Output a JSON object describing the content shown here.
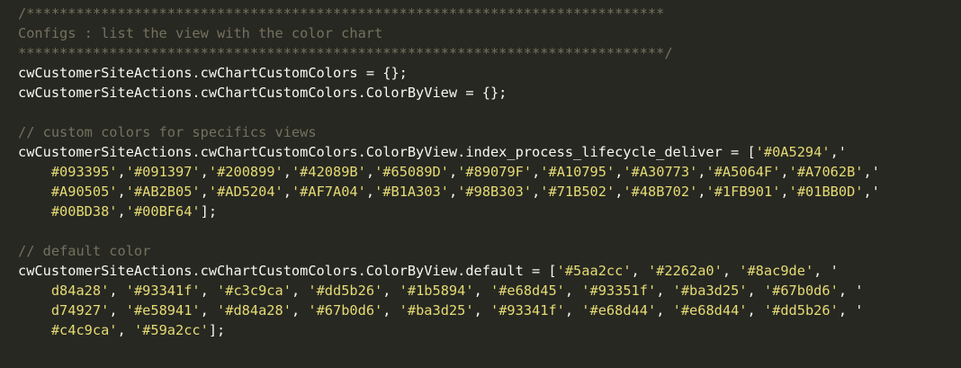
{
  "editor": {
    "lines": [
      {
        "type": "comment",
        "text": "/*****************************************************************************"
      },
      {
        "type": "comment",
        "text": "Configs : list the view with the color chart"
      },
      {
        "type": "comment",
        "text": "******************************************************************************/"
      },
      {
        "type": "code",
        "parts": [
          {
            "k": "plain",
            "t": "cwCustomerSiteActions.cwChartCustomColors "
          },
          {
            "k": "op",
            "t": "="
          },
          {
            "k": "plain",
            "t": " {};"
          }
        ]
      },
      {
        "type": "code",
        "parts": [
          {
            "k": "plain",
            "t": "cwCustomerSiteActions.cwChartCustomColors.ColorByView "
          },
          {
            "k": "op",
            "t": "="
          },
          {
            "k": "plain",
            "t": " {};"
          }
        ]
      },
      {
        "type": "blank",
        "text": ""
      },
      {
        "type": "comment",
        "text": "// custom colors for specifics views"
      },
      {
        "type": "code",
        "parts": [
          {
            "k": "plain",
            "t": "cwCustomerSiteActions.cwChartCustomColors.ColorByView.index_process_lifecycle_deliver "
          },
          {
            "k": "op",
            "t": "="
          },
          {
            "k": "plain",
            "t": " ["
          },
          {
            "k": "str",
            "t": "'#0A5294'"
          },
          {
            "k": "plain",
            "t": ",'"
          }
        ]
      },
      {
        "type": "code",
        "parts": [
          {
            "k": "plain",
            "t": "    "
          },
          {
            "k": "str",
            "t": "#093395'"
          },
          {
            "k": "plain",
            "t": ","
          },
          {
            "k": "str",
            "t": "'#091397'"
          },
          {
            "k": "plain",
            "t": ","
          },
          {
            "k": "str",
            "t": "'#200899'"
          },
          {
            "k": "plain",
            "t": ","
          },
          {
            "k": "str",
            "t": "'#42089B'"
          },
          {
            "k": "plain",
            "t": ","
          },
          {
            "k": "str",
            "t": "'#65089D'"
          },
          {
            "k": "plain",
            "t": ","
          },
          {
            "k": "str",
            "t": "'#89079F'"
          },
          {
            "k": "plain",
            "t": ","
          },
          {
            "k": "str",
            "t": "'#A10795'"
          },
          {
            "k": "plain",
            "t": ","
          },
          {
            "k": "str",
            "t": "'#A30773'"
          },
          {
            "k": "plain",
            "t": ","
          },
          {
            "k": "str",
            "t": "'#A5064F'"
          },
          {
            "k": "plain",
            "t": ","
          },
          {
            "k": "str",
            "t": "'#A7062B'"
          },
          {
            "k": "plain",
            "t": ",'"
          }
        ]
      },
      {
        "type": "code",
        "parts": [
          {
            "k": "plain",
            "t": "    "
          },
          {
            "k": "str",
            "t": "#A90505'"
          },
          {
            "k": "plain",
            "t": ","
          },
          {
            "k": "str",
            "t": "'#AB2B05'"
          },
          {
            "k": "plain",
            "t": ","
          },
          {
            "k": "str",
            "t": "'#AD5204'"
          },
          {
            "k": "plain",
            "t": ","
          },
          {
            "k": "str",
            "t": "'#AF7A04'"
          },
          {
            "k": "plain",
            "t": ","
          },
          {
            "k": "str",
            "t": "'#B1A303'"
          },
          {
            "k": "plain",
            "t": ","
          },
          {
            "k": "str",
            "t": "'#98B303'"
          },
          {
            "k": "plain",
            "t": ","
          },
          {
            "k": "str",
            "t": "'#71B502'"
          },
          {
            "k": "plain",
            "t": ","
          },
          {
            "k": "str",
            "t": "'#48B702'"
          },
          {
            "k": "plain",
            "t": ","
          },
          {
            "k": "str",
            "t": "'#1FB901'"
          },
          {
            "k": "plain",
            "t": ","
          },
          {
            "k": "str",
            "t": "'#01BB0D'"
          },
          {
            "k": "plain",
            "t": ",'"
          }
        ]
      },
      {
        "type": "code",
        "parts": [
          {
            "k": "plain",
            "t": "    "
          },
          {
            "k": "str",
            "t": "#00BD38'"
          },
          {
            "k": "plain",
            "t": ","
          },
          {
            "k": "str",
            "t": "'#00BF64'"
          },
          {
            "k": "plain",
            "t": "];"
          }
        ]
      },
      {
        "type": "blank",
        "text": ""
      },
      {
        "type": "comment",
        "text": "// default color"
      },
      {
        "type": "code",
        "parts": [
          {
            "k": "plain",
            "t": "cwCustomerSiteActions.cwChartCustomColors.ColorByView.default "
          },
          {
            "k": "op",
            "t": "="
          },
          {
            "k": "plain",
            "t": " ["
          },
          {
            "k": "str",
            "t": "'#5aa2cc'"
          },
          {
            "k": "plain",
            "t": ", "
          },
          {
            "k": "str",
            "t": "'#2262a0'"
          },
          {
            "k": "plain",
            "t": ", "
          },
          {
            "k": "str",
            "t": "'#8ac9de'"
          },
          {
            "k": "plain",
            "t": ", '"
          }
        ]
      },
      {
        "type": "code",
        "parts": [
          {
            "k": "plain",
            "t": "    "
          },
          {
            "k": "str",
            "t": "d84a28'"
          },
          {
            "k": "plain",
            "t": ", "
          },
          {
            "k": "str",
            "t": "'#93341f'"
          },
          {
            "k": "plain",
            "t": ", "
          },
          {
            "k": "str",
            "t": "'#c3c9ca'"
          },
          {
            "k": "plain",
            "t": ", "
          },
          {
            "k": "str",
            "t": "'#dd5b26'"
          },
          {
            "k": "plain",
            "t": ", "
          },
          {
            "k": "str",
            "t": "'#1b5894'"
          },
          {
            "k": "plain",
            "t": ", "
          },
          {
            "k": "str",
            "t": "'#e68d45'"
          },
          {
            "k": "plain",
            "t": ", "
          },
          {
            "k": "str",
            "t": "'#93351f'"
          },
          {
            "k": "plain",
            "t": ", "
          },
          {
            "k": "str",
            "t": "'#ba3d25'"
          },
          {
            "k": "plain",
            "t": ", "
          },
          {
            "k": "str",
            "t": "'#67b0d6'"
          },
          {
            "k": "plain",
            "t": ", '"
          }
        ]
      },
      {
        "type": "code",
        "parts": [
          {
            "k": "plain",
            "t": "    "
          },
          {
            "k": "str",
            "t": "d74927'"
          },
          {
            "k": "plain",
            "t": ", "
          },
          {
            "k": "str",
            "t": "'#e58941'"
          },
          {
            "k": "plain",
            "t": ", "
          },
          {
            "k": "str",
            "t": "'#d84a28'"
          },
          {
            "k": "plain",
            "t": ", "
          },
          {
            "k": "str",
            "t": "'#67b0d6'"
          },
          {
            "k": "plain",
            "t": ", "
          },
          {
            "k": "str",
            "t": "'#ba3d25'"
          },
          {
            "k": "plain",
            "t": ", "
          },
          {
            "k": "str",
            "t": "'#93341f'"
          },
          {
            "k": "plain",
            "t": ", "
          },
          {
            "k": "str",
            "t": "'#e68d44'"
          },
          {
            "k": "plain",
            "t": ", "
          },
          {
            "k": "str",
            "t": "'#e68d44'"
          },
          {
            "k": "plain",
            "t": ", "
          },
          {
            "k": "str",
            "t": "'#dd5b26'"
          },
          {
            "k": "plain",
            "t": ", '"
          }
        ]
      },
      {
        "type": "code",
        "parts": [
          {
            "k": "plain",
            "t": "    "
          },
          {
            "k": "str",
            "t": "#c4c9ca'"
          },
          {
            "k": "plain",
            "t": ", "
          },
          {
            "k": "str",
            "t": "'#59a2cc'"
          },
          {
            "k": "plain",
            "t": "];"
          }
        ]
      }
    ]
  }
}
